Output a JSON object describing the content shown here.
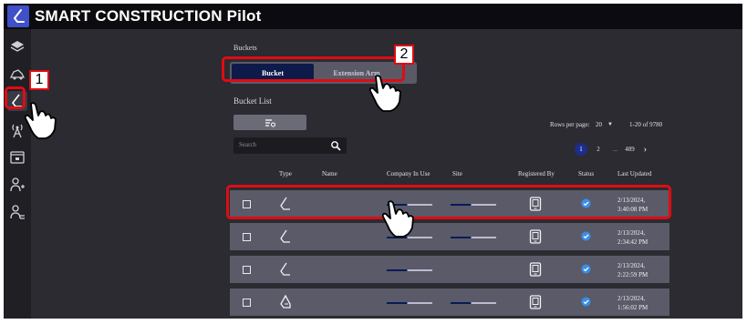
{
  "app": {
    "title": "SMART CONSTRUCTION Pilot"
  },
  "sidebar": {
    "items": [
      {
        "icon": "layers-icon"
      },
      {
        "icon": "machines-icon"
      },
      {
        "icon": "bucket-icon",
        "active": true
      },
      {
        "icon": "antenna-icon"
      },
      {
        "icon": "cloud-screen-icon"
      },
      {
        "icon": "user-add-icon"
      },
      {
        "icon": "user-group-icon"
      }
    ]
  },
  "breadcrumb": "Buckets",
  "tabs": [
    {
      "label": "Bucket",
      "active": true
    },
    {
      "label": "Extension Arm",
      "active": false
    }
  ],
  "list": {
    "title": "Bucket List",
    "search_placeholder": "Search",
    "rows_per_page_label": "Rows per page:",
    "rows_per_page_value": "20",
    "range": "1-20 of 9780",
    "pages": [
      "1",
      "2",
      "...",
      "489"
    ],
    "current_page": "1",
    "columns": [
      "Type",
      "Name",
      "Company In Use",
      "Site",
      "Registered By",
      "Status",
      "Last Updated"
    ],
    "rows": [
      {
        "type": "bucket-icon",
        "name": "",
        "status": "verified",
        "updated_date": "2/13/2024,",
        "updated_time": "3:40:08 PM"
      },
      {
        "type": "bucket-icon",
        "name": "",
        "status": "verified",
        "updated_date": "2/13/2024,",
        "updated_time": "2:34:42 PM"
      },
      {
        "type": "bucket-icon",
        "name": "",
        "status": "verified",
        "updated_date": "2/13/2024,",
        "updated_time": "2:22:59 PM"
      },
      {
        "type": "slope-bucket-icon",
        "name": "",
        "status": "verified",
        "updated_date": "2/13/2024,",
        "updated_time": "1:56:02 PM"
      }
    ]
  },
  "annotations": {
    "step1": "1",
    "step2": "2",
    "highlight_color": "#e00b14"
  },
  "colors": {
    "accent": "#1c2d8c",
    "active_tab": "#0e1a4a",
    "status_blue": "#3a8ee6",
    "topbar": "#0c0c10"
  }
}
